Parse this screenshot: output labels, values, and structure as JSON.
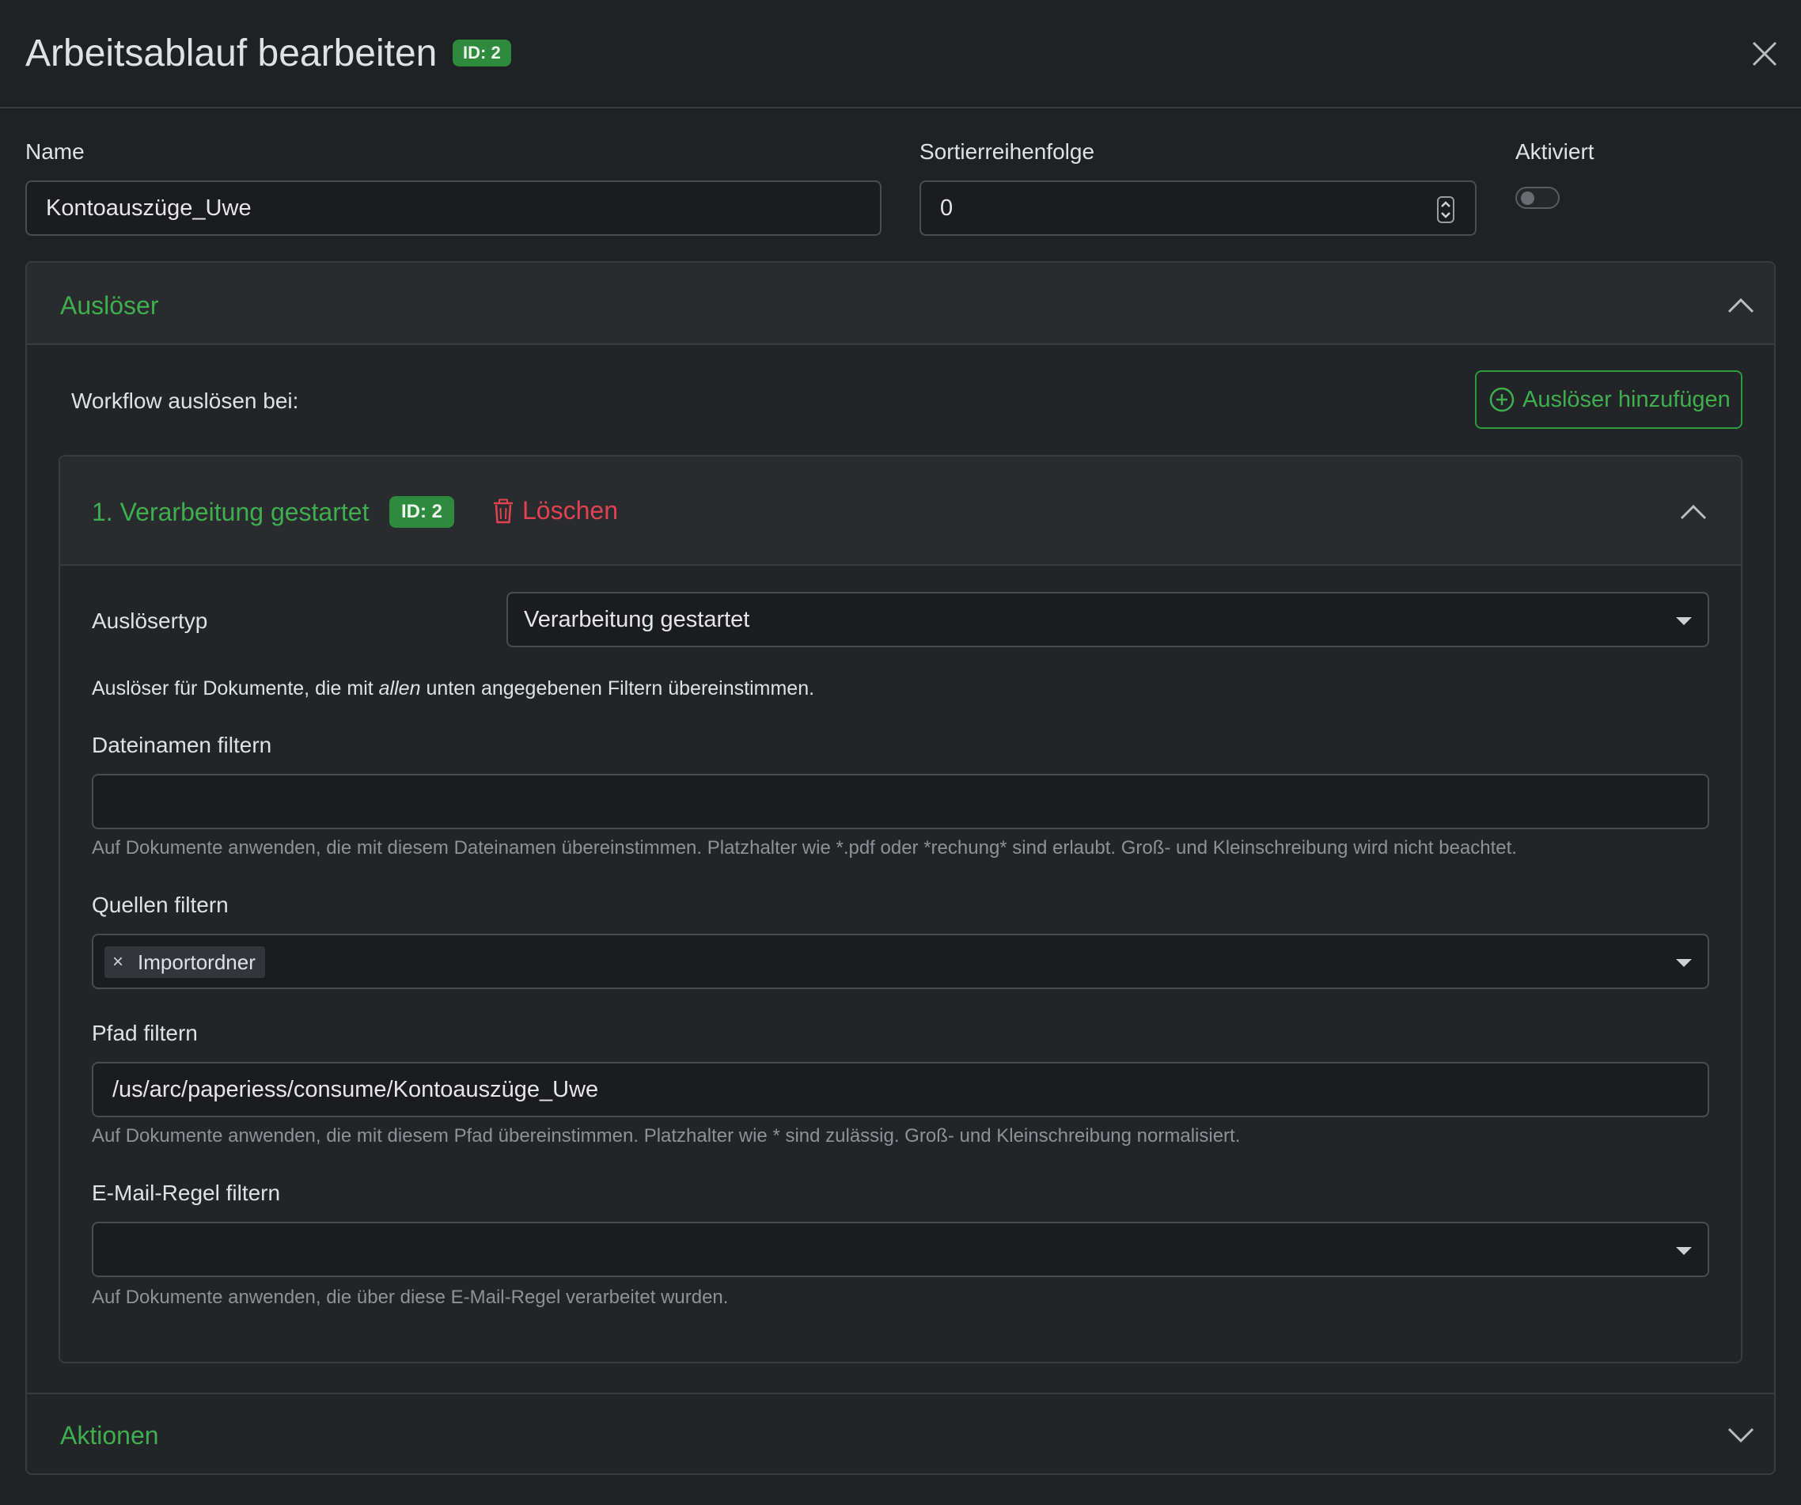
{
  "header": {
    "title": "Arbeitsablauf bearbeiten",
    "id_badge": "ID: 2"
  },
  "form": {
    "name_label": "Name",
    "name_value": "Kontoauszüge_Uwe",
    "sort_label": "Sortierreihenfolge",
    "sort_value": "0",
    "enabled_label": "Aktiviert",
    "enabled": false
  },
  "triggers": {
    "section_title": "Auslöser",
    "workflow_label": "Workflow auslösen bei:",
    "add_button": "Auslöser hinzufügen",
    "items": [
      {
        "title": "1. Verarbeitung gestartet",
        "id_badge": "ID: 2",
        "delete_label": "Löschen",
        "type_label": "Auslösertyp",
        "type_value": "Verarbeitung gestartet",
        "description_prefix": "Auslöser für Dokumente, die mit",
        "description_emphasis": "allen",
        "description_suffix": "unten angegebenen Filtern übereinstimmen.",
        "filename_label": "Dateinamen filtern",
        "filename_value": "",
        "filename_help": "Auf Dokumente anwenden, die mit diesem Dateinamen übereinstimmen. Platzhalter wie *.pdf oder *rechung* sind erlaubt. Groß- und Kleinschreibung wird nicht beachtet.",
        "sources_label": "Quellen filtern",
        "sources_tags": [
          "Importordner"
        ],
        "sources_tag_remove": "×",
        "path_label": "Pfad filtern",
        "path_value": "/us/arc/paperiess/consume/Kontoauszüge_Uwe",
        "path_help": "Auf Dokumente anwenden, die mit diesem Pfad übereinstimmen. Platzhalter wie * sind zulässig. Groß- und Kleinschreibung normalisiert.",
        "mailrule_label": "E-Mail-Regel filtern",
        "mailrule_value": "",
        "mailrule_help": "Auf Dokumente anwenden, die über diese E-Mail-Regel verarbeitet wurden."
      }
    ]
  },
  "actions": {
    "section_title": "Aktionen"
  },
  "colors": {
    "accent_green": "#3fae4e",
    "danger_red": "#e0434f",
    "background": "#202124"
  },
  "icons": {
    "close": "close-icon",
    "collapse": "chevron-up-icon",
    "expand": "chevron-down-icon",
    "add": "plus-circle-icon",
    "delete": "trash-icon",
    "spinner": "number-spinner-icon"
  }
}
